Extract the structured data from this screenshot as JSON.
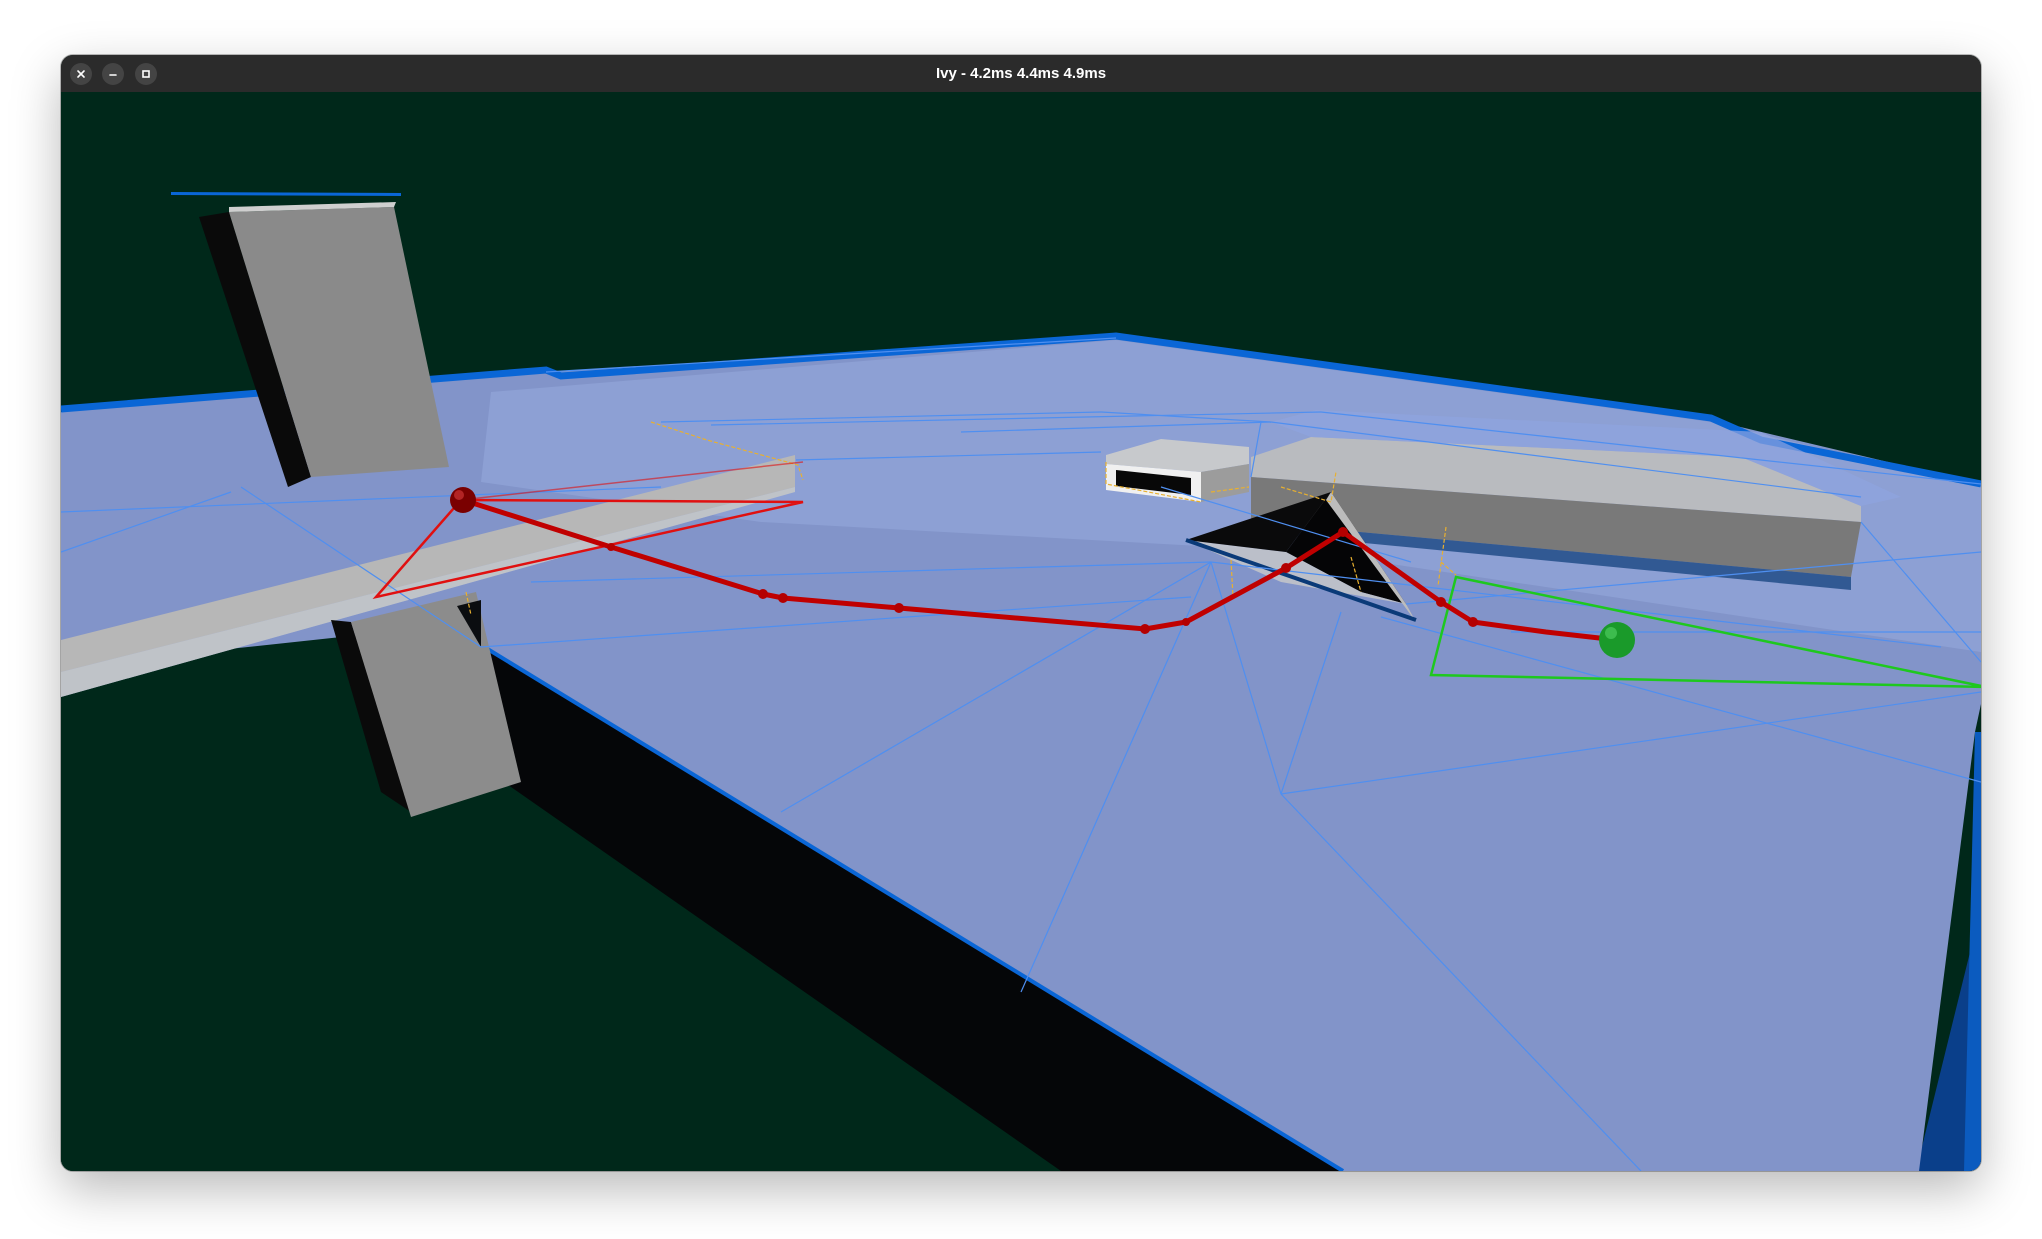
{
  "window": {
    "title": "Ivy - 4.2ms 4.4ms 4.9ms",
    "buttons": [
      {
        "icon": "close-icon"
      },
      {
        "icon": "minimize-icon"
      },
      {
        "icon": "maximize-icon"
      }
    ]
  },
  "viewport": {
    "background": "#00281a",
    "navmesh_fill": "#8a9ed6",
    "navmesh_edge": "#0a66d6",
    "path_color": "#c00000",
    "start_marker_color": "#8b0000",
    "goal_marker_color": "#1a9a2a",
    "goal_fan_color": "#1ec81e",
    "portal_color": "#e8b030"
  }
}
